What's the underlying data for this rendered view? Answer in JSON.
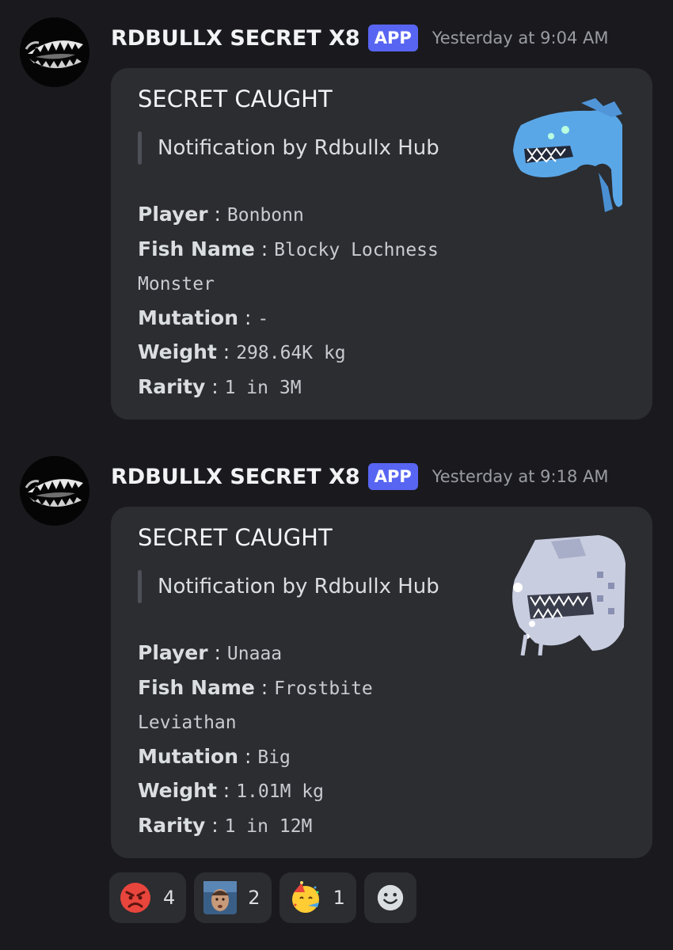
{
  "messages": [
    {
      "username": "RDBULLX SECRET X8",
      "badge": "APP",
      "timestamp": "Yesterday at 9:04 AM",
      "embed": {
        "title": "SECRET CAUGHT",
        "quote": "Notification by Rdbullx Hub",
        "thumbnail_icon": "blue-lochness-monster-icon",
        "fields": [
          {
            "label": "Player",
            "value": "Bonbonn"
          },
          {
            "label": "Fish Name",
            "value": "Blocky Lochness Monster"
          },
          {
            "label": "Mutation",
            "value": "-"
          },
          {
            "label": "Weight",
            "value": "298.64K kg"
          },
          {
            "label": "Rarity",
            "value": "1 in 3M"
          }
        ]
      }
    },
    {
      "username": "RDBULLX SECRET X8",
      "badge": "APP",
      "timestamp": "Yesterday at 9:18 AM",
      "embed": {
        "title": "SECRET CAUGHT",
        "quote": "Notification by Rdbullx Hub",
        "thumbnail_icon": "frostbite-leviathan-icon",
        "fields": [
          {
            "label": "Player",
            "value": "Unaaa"
          },
          {
            "label": "Fish Name",
            "value": "Frostbite Leviathan"
          },
          {
            "label": "Mutation",
            "value": "Big"
          },
          {
            "label": "Weight",
            "value": "1.01M kg"
          },
          {
            "label": "Rarity",
            "value": "1 in 12M"
          }
        ]
      }
    }
  ],
  "reactions": [
    {
      "emoji": "angry-face-icon",
      "count": "4"
    },
    {
      "emoji": "man-face-emoji-icon",
      "count": "2"
    },
    {
      "emoji": "partying-face-icon",
      "count": "1"
    }
  ],
  "add_reaction_icon": "add-reaction-smiley-icon",
  "colors": {
    "background": "#1a1a1e",
    "embed": "#2b2d31",
    "badge": "#5865f2",
    "timestamp": "#9a9ca3"
  }
}
